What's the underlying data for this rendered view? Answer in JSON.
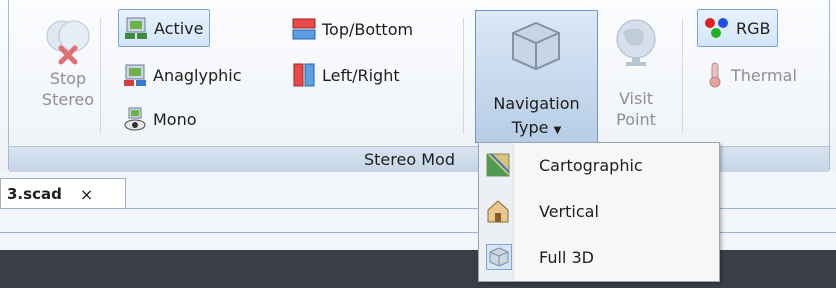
{
  "ribbon": {
    "group_label": "Stereo Mod",
    "stop_stereo": [
      "Stop",
      "Stereo"
    ],
    "modes": {
      "active": "Active",
      "anaglyphic": "Anaglyphic",
      "mono": "Mono",
      "top_bottom": "Top/Bottom",
      "left_right": "Left/Right"
    },
    "navigation_type": [
      "Navigation",
      "Type"
    ],
    "visit_point": [
      "Visit",
      "Point"
    ],
    "color": {
      "rgb": "RGB",
      "thermal": "Thermal"
    }
  },
  "document": {
    "tab_name": "3.scad",
    "close_glyph": "×"
  },
  "dropdown": {
    "items": [
      {
        "label": "Cartographic",
        "icon": "map-icon"
      },
      {
        "label": "Vertical",
        "icon": "house-icon"
      },
      {
        "label": "Full 3D",
        "icon": "cube-icon",
        "selected": true
      }
    ]
  },
  "colors": {
    "accent": "#7ea6d4",
    "selected_bg": "#b7cde6",
    "dark_panel": "#3a3e46"
  }
}
